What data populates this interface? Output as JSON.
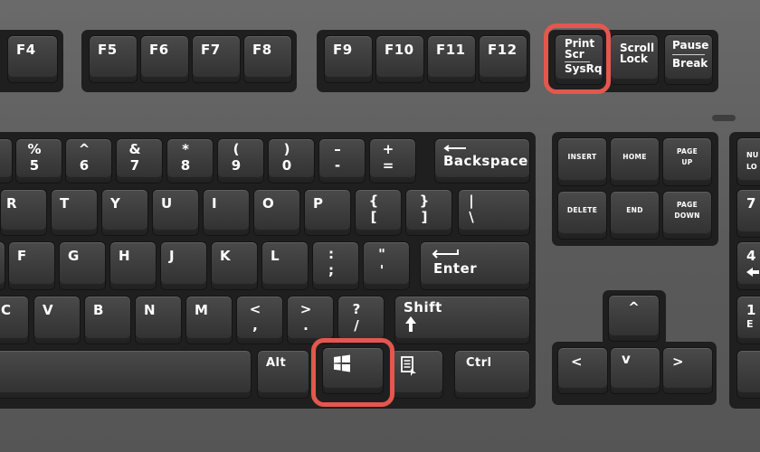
{
  "keys": {
    "f4": "F4",
    "f5": "F5",
    "f6": "F6",
    "f7": "F7",
    "f8": "F8",
    "f9": "F9",
    "f10": "F10",
    "f11": "F11",
    "f12": "F12",
    "print_screen": {
      "line1": "Print",
      "line2": "Scr",
      "line3": "SysRq"
    },
    "scroll_lock": {
      "line1": "Scroll",
      "line2": "Lock"
    },
    "pause_break": {
      "top": "Pause",
      "bottom": "Break"
    },
    "num_row": [
      {
        "top": "%",
        "bottom": "5"
      },
      {
        "top": "^",
        "bottom": "6"
      },
      {
        "top": "&",
        "bottom": "7"
      },
      {
        "top": "*",
        "bottom": "8"
      },
      {
        "top": "(",
        "bottom": "9"
      },
      {
        "top": ")",
        "bottom": "0"
      },
      {
        "top": "–",
        "bottom": "-"
      },
      {
        "top": "+",
        "bottom": "="
      }
    ],
    "backspace": "Backspace",
    "top_row": [
      "R",
      "T",
      "Y",
      "U",
      "I",
      "O",
      "P"
    ],
    "brackets": [
      {
        "top": "{",
        "bottom": "["
      },
      {
        "top": "}",
        "bottom": "]"
      },
      {
        "top": "|",
        "bottom": "\\"
      }
    ],
    "home_row": [
      "F",
      "G",
      "H",
      "J",
      "K",
      "L"
    ],
    "home_punct": [
      {
        "top": ":",
        "bottom": ";"
      },
      {
        "top": "\"",
        "bottom": "'"
      }
    ],
    "enter": "Enter",
    "bottom_letter_row": [
      "C",
      "V",
      "B",
      "N",
      "M"
    ],
    "bottom_punct": [
      {
        "top": "<",
        "bottom": ","
      },
      {
        "top": ">",
        "bottom": "."
      },
      {
        "top": "?",
        "bottom": "/"
      }
    ],
    "shift": "Shift",
    "alt": "Alt",
    "ctrl": "Ctrl",
    "nav": {
      "insert": "INSERT",
      "home": "HOME",
      "page_up_1": "PAGE",
      "page_up_2": "UP",
      "delete": "DELETE",
      "end": "END",
      "page_down_1": "PAGE",
      "page_down_2": "DOWN"
    },
    "arrows": {
      "up": "^",
      "left": "<",
      "down": "v",
      "right": ">"
    },
    "numpad_edge": {
      "num_1": "NU",
      "num_2": "LO",
      "digit_7": "7",
      "digit_4": "4",
      "digit_1": "1",
      "letter_e": "E"
    }
  },
  "highlight_color": "#e4574e",
  "icons": [
    "windows-logo-icon",
    "menu-document-icon",
    "arrow-up-icon",
    "arrow-left-icon",
    "shift-arrow-icon"
  ]
}
